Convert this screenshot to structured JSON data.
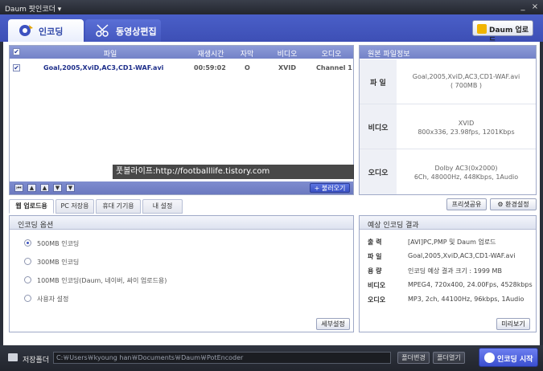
{
  "window": {
    "title": "Daum 팟인코더 ▾",
    "minimize": "_",
    "close": "×"
  },
  "tabs": {
    "encode": "인코딩",
    "edit": "동영상편집"
  },
  "daum_upload": "Daum 업로드",
  "filelist": {
    "headers": {
      "check": "✔",
      "file": "파일",
      "duration": "재생시간",
      "subtitle": "자막",
      "video": "비디오",
      "audio": "오디오"
    },
    "rows": [
      {
        "checked": "✔",
        "file": "Goal,2005,XviD,AC3,CD1-WAF.avi",
        "duration": "00:59:02",
        "subtitle": "O",
        "video": "XVID",
        "audio": "Channel 1"
      }
    ],
    "add_button": "+ 불러오기",
    "nav": [
      "⏮",
      "▲",
      "▲",
      "▼",
      "▼"
    ]
  },
  "watermark": "풋볼라이프:http://footballlife.tistory.com",
  "origin": {
    "title": "원본 파일정보",
    "file_label": "파 일",
    "file_lines": [
      "Goal,2005,XviD,AC3,CD1-WAF.avi",
      "( 700MB )"
    ],
    "video_label": "비디오",
    "video_lines": [
      "XVID",
      "800x336, 23.98fps, 1201Kbps"
    ],
    "audio_label": "오디오",
    "audio_lines": [
      "Dolby AC3(0x2000)",
      "6Ch, 48000Hz, 448Kbps, 1Audio"
    ]
  },
  "subtabs": [
    "웹 업로드용",
    "PC 저장용",
    "휴대 기기용",
    "내 설정"
  ],
  "preset_share": "프리셋공유",
  "env_settings": "환경설정",
  "options": {
    "title": "인코딩 옵션",
    "items": [
      "500MB 인코딩",
      "300MB 인코딩",
      "100MB 인코딩(Daum, 네이버, 싸이 업로드용)",
      "사용자 설정"
    ],
    "detail_button": "세부설정"
  },
  "result": {
    "title": "예상 인코딩 결과",
    "rows": [
      {
        "label": "출 력",
        "value": "[AVI]PC,PMP 및 Daum 업로드"
      },
      {
        "label": "파 일",
        "value": "Goal,2005,XviD,AC3,CD1-WAF.avi"
      },
      {
        "label": "용 량",
        "value": "인코딩 예상 결과 크기 : 1999 MB"
      },
      {
        "label": "비디오",
        "value": "MPEG4, 720x400, 24.00Fps, 4528kbps"
      },
      {
        "label": "오디오",
        "value": "MP3, 2ch, 44100Hz, 96kbps, 1Audio"
      }
    ],
    "preview_button": "미리보기"
  },
  "bottom": {
    "folder_label": "저장폴더",
    "path": "C:￦Users￦kyoung han￦Documents￦Daum￦PotEncoder",
    "change_folder": "폴더변경",
    "open_folder": "폴더열기",
    "start": "인코딩 시작"
  },
  "colors": {
    "accent": "#3d4fb5",
    "header": "#7382c8"
  }
}
